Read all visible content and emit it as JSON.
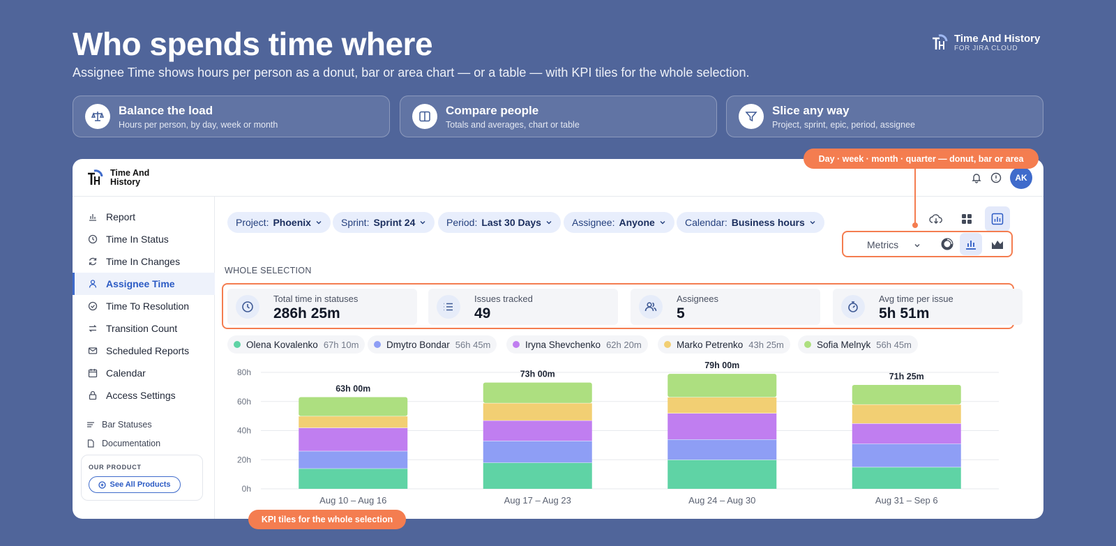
{
  "hero": {
    "title": "Who spends time where",
    "subtitle": "Assignee Time shows hours per person as a donut, bar or area chart — or a table — with KPI tiles for the whole selection."
  },
  "brand": {
    "name": "Time And History",
    "sub": "FOR JIRA CLOUD",
    "card_line1": "Time And",
    "card_line2": "History"
  },
  "features": [
    {
      "icon": "scale-icon",
      "title": "Balance the load",
      "sub": "Hours per person, by day, week or month"
    },
    {
      "icon": "columns-icon",
      "title": "Compare people",
      "sub": "Totals and averages, chart or table"
    },
    {
      "icon": "funnel-icon",
      "title": "Slice any way",
      "sub": "Project, sprint, epic, period, assignee"
    }
  ],
  "header": {
    "avatar": "AK"
  },
  "sidebar": {
    "items": [
      {
        "label": "Report",
        "icon": "bar-chart-icon"
      },
      {
        "label": "Time In Status",
        "icon": "clock-icon"
      },
      {
        "label": "Time In Changes",
        "icon": "refresh-icon"
      },
      {
        "label": "Assignee Time",
        "icon": "user-icon",
        "active": true
      },
      {
        "label": "Time To Resolution",
        "icon": "check-circle-icon"
      },
      {
        "label": "Transition Count",
        "icon": "arrows-icon"
      },
      {
        "label": "Scheduled Reports",
        "icon": "mail-icon"
      },
      {
        "label": "Calendar",
        "icon": "calendar-icon"
      },
      {
        "label": "Access Settings",
        "icon": "lock-icon"
      }
    ],
    "secondary": [
      {
        "label": "Bar Statuses",
        "icon": "list-icon"
      },
      {
        "label": "Documentation",
        "icon": "document-icon"
      }
    ],
    "product_label": "OUR PRODUCT",
    "product_button": "See All Products"
  },
  "filters": [
    {
      "key": "Project:",
      "value": "Phoenix"
    },
    {
      "key": "Sprint:",
      "value": "Sprint 24"
    },
    {
      "key": "Period:",
      "value": "Last 30 Days"
    },
    {
      "key": "Assignee:",
      "value": "Anyone"
    },
    {
      "key": "Calendar:",
      "value": "Business hours"
    }
  ],
  "view": {
    "metrics_label": "Metrics"
  },
  "callouts": {
    "top": "Day · week · month · quarter — donut, bar or area",
    "bottom": "KPI tiles for the whole selection"
  },
  "section_label": "WHOLE SELECTION",
  "kpis": [
    {
      "label": "Total time in statuses",
      "value": "286h 25m",
      "icon": "clock-icon"
    },
    {
      "label": "Issues tracked",
      "value": "49",
      "icon": "list-icon"
    },
    {
      "label": "Assignees",
      "value": "5",
      "icon": "users-icon"
    },
    {
      "label": "Avg time per issue",
      "value": "5h 51m",
      "icon": "stopwatch-icon"
    }
  ],
  "legend": [
    {
      "name": "Olena Kovalenko",
      "hours": "67h 10m",
      "color": "#5fd3a5"
    },
    {
      "name": "Dmytro Bondar",
      "hours": "56h 45m",
      "color": "#8e9ef5"
    },
    {
      "name": "Iryna Shevchenko",
      "hours": "62h 20m",
      "color": "#c07ef0"
    },
    {
      "name": "Marko Petrenko",
      "hours": "43h 25m",
      "color": "#f2cf73"
    },
    {
      "name": "Sofia Melnyk",
      "hours": "56h 45m",
      "color": "#addf80"
    }
  ],
  "chart_data": {
    "type": "bar",
    "stacked": true,
    "categories": [
      "Aug 10 – Aug 16",
      "Aug 17 – Aug 23",
      "Aug 24 – Aug 30",
      "Aug 31 – Sep 6"
    ],
    "series": [
      {
        "name": "Olena Kovalenko",
        "values": [
          14,
          18,
          20,
          15
        ],
        "color": "#5fd3a5"
      },
      {
        "name": "Dmytro Bondar",
        "values": [
          12,
          15,
          14,
          16
        ],
        "color": "#8e9ef5"
      },
      {
        "name": "Iryna Shevchenko",
        "values": [
          16,
          14,
          18,
          14
        ],
        "color": "#c07ef0"
      },
      {
        "name": "Marko Petrenko",
        "values": [
          8,
          12,
          11,
          13
        ],
        "color": "#f2cf73"
      },
      {
        "name": "Sofia Melnyk",
        "values": [
          13,
          14,
          16,
          13.4
        ],
        "color": "#addf80"
      }
    ],
    "totals": [
      "63h 00m",
      "73h 00m",
      "79h 00m",
      "71h 25m"
    ],
    "yticks": [
      "80h",
      "60h",
      "40h",
      "20h",
      "0h"
    ],
    "ylim": [
      0,
      80
    ],
    "grid": true
  }
}
